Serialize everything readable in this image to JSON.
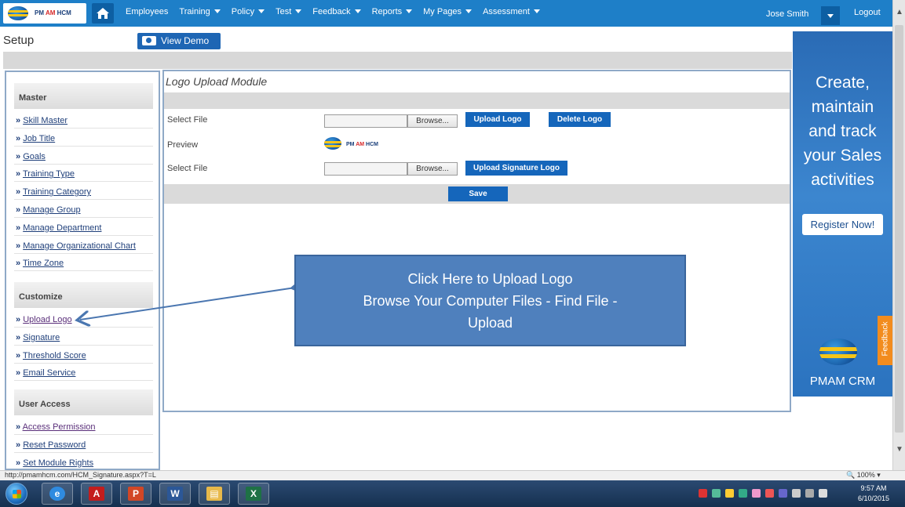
{
  "logo": {
    "brand_pm": "PM",
    "brand_am": "AM",
    "brand_hcm": "HCM"
  },
  "nav": {
    "items": [
      {
        "label": "Employees",
        "has_caret": false
      },
      {
        "label": "Training",
        "has_caret": true
      },
      {
        "label": "Policy",
        "has_caret": true
      },
      {
        "label": "Test",
        "has_caret": true
      },
      {
        "label": "Feedback",
        "has_caret": true
      },
      {
        "label": "Reports",
        "has_caret": true
      },
      {
        "label": "My Pages",
        "has_caret": true
      },
      {
        "label": "Assessment",
        "has_caret": true
      }
    ],
    "user_name": "Jose Smith",
    "logout_label": "Logout"
  },
  "header": {
    "title": "Setup",
    "view_demo_label": "View Demo"
  },
  "sidebar": {
    "sections": [
      {
        "title": "Master",
        "items": [
          "Skill Master",
          "Job Title",
          "Goals",
          "Training Type",
          "Training Category",
          "Manage Group",
          "Manage Department",
          "Manage Organizational Chart",
          "Time Zone"
        ]
      },
      {
        "title": "Customize",
        "items": [
          "Upload Logo",
          "Signature",
          "Threshold Score",
          "Email Service"
        ]
      },
      {
        "title": "User Access",
        "items": [
          "Access Permission",
          "Reset Password",
          "Set Module Rights"
        ]
      }
    ],
    "bullet": "»"
  },
  "main": {
    "title": "Logo Upload Module",
    "row1_label": "Select File",
    "preview_label": "Preview",
    "row2_label": "Select File",
    "browse_label": "Browse...",
    "upload_logo_label": "Upload Logo",
    "delete_logo_label": "Delete Logo",
    "upload_signature_label": "Upload Signature Logo",
    "save_label": "Save"
  },
  "callout": {
    "line1": "Click Here to Upload Logo",
    "line2": "Browse Your Computer Files - Find File  -",
    "line3": "Upload"
  },
  "ad": {
    "headline_lines": [
      "Create,",
      "maintain",
      "and track",
      "your Sales",
      "activities"
    ],
    "register_label": "Register Now!",
    "brand": "PMAM CRM",
    "feedback_label": "Feedback"
  },
  "statusbar": {
    "url": "http://pmamhcm.com/HCM_Signature.aspx?T=L",
    "zoom": "100%"
  },
  "taskbar": {
    "time": "9:57 AM",
    "date": "6/10/2015"
  },
  "colors": {
    "nav_bg": "#1e7fc8",
    "button_blue": "#1566bb",
    "callout_bg": "#4f80bd",
    "feedback_orange": "#f28c1e"
  },
  "icons": {
    "home": "home-icon",
    "camera": "camera-icon",
    "start": "windows-start-icon"
  }
}
